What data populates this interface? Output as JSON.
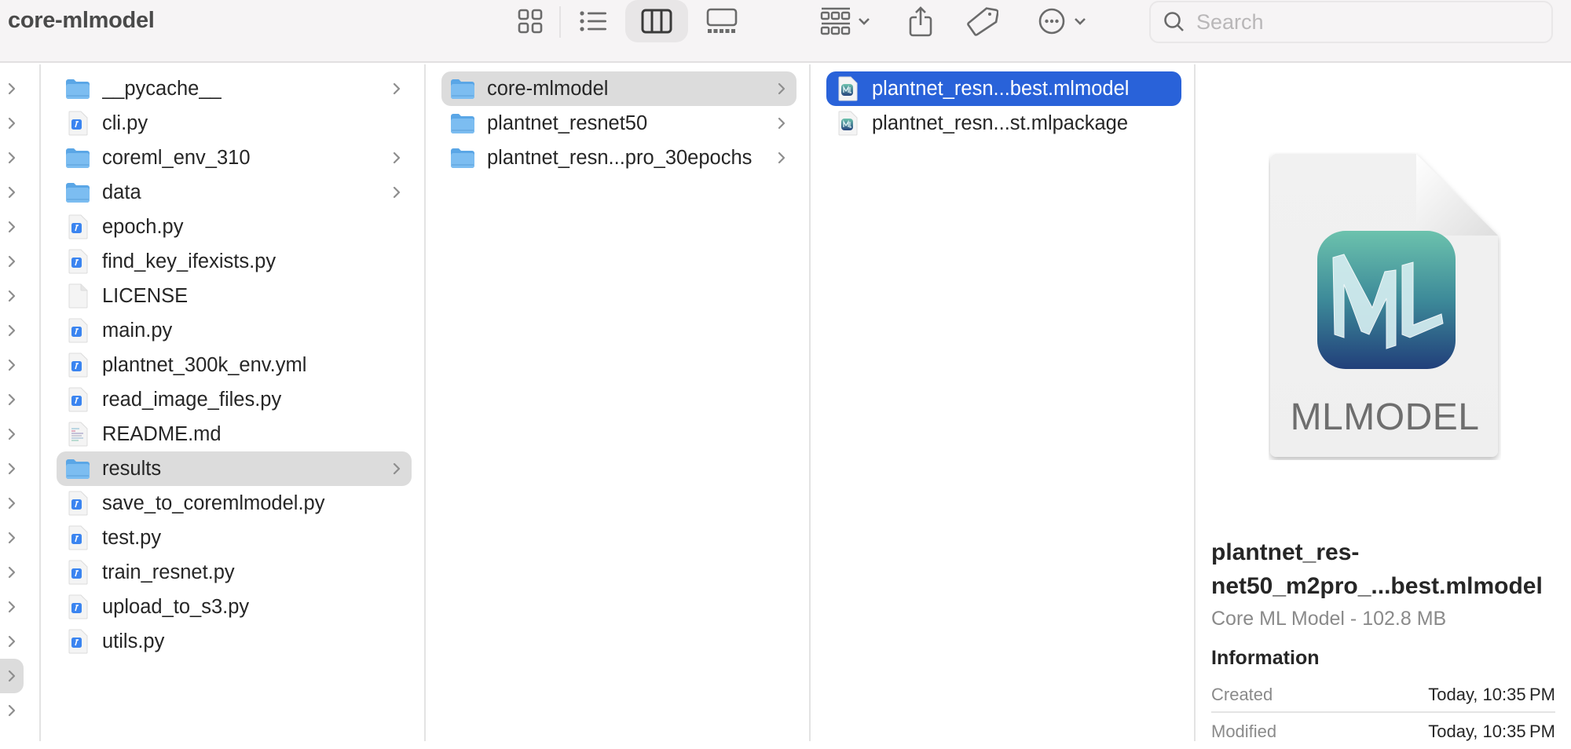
{
  "window": {
    "title": "core-mlmodel"
  },
  "toolbar": {
    "view_buttons": [
      {
        "name": "icon-view",
        "icon": "grid-icon",
        "active": false
      },
      {
        "name": "list-view",
        "icon": "list-icon",
        "active": false
      },
      {
        "name": "column-view",
        "icon": "columns-icon",
        "active": true
      },
      {
        "name": "gallery-view",
        "icon": "gallery-icon",
        "active": false
      }
    ],
    "group_button": {
      "icon": "group-icon"
    },
    "share_button": {
      "icon": "share-icon"
    },
    "tags_button": {
      "icon": "tag-icon"
    },
    "more_button": {
      "icon": "ellipsis-circle-icon"
    },
    "search": {
      "placeholder": "Search",
      "value": ""
    }
  },
  "columns": {
    "col0": {
      "selected_index": 17,
      "count": 19
    },
    "col1": {
      "items": [
        {
          "name": "__pycache__",
          "type": "folder",
          "has_children": true
        },
        {
          "name": "cli.py",
          "type": "python",
          "has_children": false
        },
        {
          "name": "coreml_env_310",
          "type": "folder",
          "has_children": true
        },
        {
          "name": "data",
          "type": "folder",
          "has_children": true
        },
        {
          "name": "epoch.py",
          "type": "python",
          "has_children": false
        },
        {
          "name": "find_key_ifexists.py",
          "type": "python",
          "has_children": false
        },
        {
          "name": "LICENSE",
          "type": "plain",
          "has_children": false
        },
        {
          "name": "main.py",
          "type": "python",
          "has_children": false
        },
        {
          "name": "plantnet_300k_env.yml",
          "type": "python",
          "has_children": false
        },
        {
          "name": "read_image_files.py",
          "type": "python",
          "has_children": false
        },
        {
          "name": "README.md",
          "type": "markdown",
          "has_children": false
        },
        {
          "name": "results",
          "type": "folder",
          "has_children": true,
          "selected": true
        },
        {
          "name": "save_to_coremlmodel.py",
          "type": "python",
          "has_children": false
        },
        {
          "name": "test.py",
          "type": "python",
          "has_children": false
        },
        {
          "name": "train_resnet.py",
          "type": "python",
          "has_children": false
        },
        {
          "name": "upload_to_s3.py",
          "type": "python",
          "has_children": false
        },
        {
          "name": "utils.py",
          "type": "python",
          "has_children": false
        }
      ]
    },
    "col2": {
      "items": [
        {
          "name": "core-mlmodel",
          "type": "folder",
          "has_children": true,
          "selected": true
        },
        {
          "name": "plantnet_resnet50",
          "type": "folder",
          "has_children": true
        },
        {
          "name": "plantnet_resn...pro_30epochs",
          "type": "folder",
          "has_children": true
        }
      ]
    },
    "col3": {
      "items": [
        {
          "name": "plantnet_resn...best.mlmodel",
          "type": "mlmodel",
          "selected": true,
          "focused": true
        },
        {
          "name": "plantnet_resn...st.mlpackage",
          "type": "mlmodel"
        }
      ]
    }
  },
  "preview": {
    "icon_caption": "MLMODEL",
    "icon_glyph": "ML",
    "file_name": "plantnet_res-\nnet50_m2pro_...best.mlmodel",
    "kind_size": "Core ML Model - 102.8 MB",
    "info_heading": "Information",
    "info": [
      {
        "label": "Created",
        "value": "Today, 10:35 PM"
      },
      {
        "label": "Modified",
        "value": "Today, 10:35 PM"
      }
    ]
  },
  "colors": {
    "selection_blue": "#2962d9",
    "selection_gray": "#dcdcdc",
    "folder_blue": "#6fb4ee",
    "toolbar_bg": "#f6f4f5"
  }
}
